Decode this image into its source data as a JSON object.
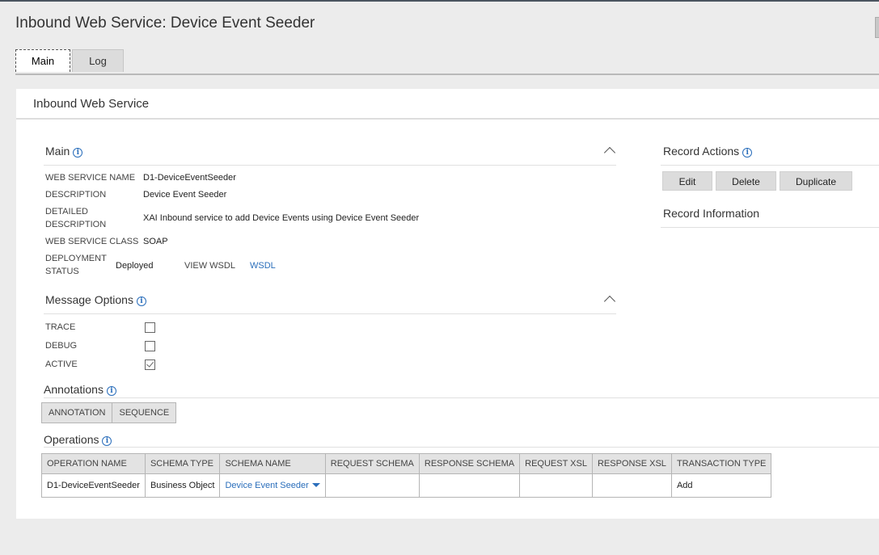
{
  "page": {
    "title": "Inbound Web Service: Device Event Seeder"
  },
  "tabs": [
    {
      "label": "Main"
    },
    {
      "label": "Log"
    }
  ],
  "card": {
    "title": "Inbound Web Service"
  },
  "main_section": {
    "title": "Main",
    "fields": {
      "web_service_name": {
        "label": "WEB SERVICE NAME",
        "value": "D1-DeviceEventSeeder"
      },
      "description": {
        "label": "DESCRIPTION",
        "value": "Device Event Seeder"
      },
      "detailed_description": {
        "label_line1": "DETAILED",
        "label_line2": "DESCRIPTION",
        "value": "XAI Inbound service to add Device Events using Device Event Seeder"
      },
      "web_service_class": {
        "label": "WEB SERVICE CLASS",
        "value": "SOAP"
      },
      "deployment_status": {
        "label_line1": "DEPLOYMENT",
        "label_line2": "STATUS",
        "value": "Deployed"
      },
      "view_wsdl": {
        "label": "VIEW WSDL",
        "value": "WSDL"
      }
    }
  },
  "message_options": {
    "title": "Message Options",
    "trace": {
      "label": "TRACE",
      "checked": false
    },
    "debug": {
      "label": "DEBUG",
      "checked": false
    },
    "active": {
      "label": "ACTIVE",
      "checked": true
    }
  },
  "annotations": {
    "title": "Annotations",
    "columns": [
      "ANNOTATION",
      "SEQUENCE"
    ]
  },
  "operations": {
    "title": "Operations",
    "columns": [
      "OPERATION NAME",
      "SCHEMA TYPE",
      "SCHEMA NAME",
      "REQUEST SCHEMA",
      "RESPONSE SCHEMA",
      "REQUEST XSL",
      "RESPONSE XSL",
      "TRANSACTION TYPE"
    ],
    "rows": [
      {
        "operation_name": "D1-DeviceEventSeeder",
        "schema_type": "Business Object",
        "schema_name": "Device Event Seeder",
        "request_schema": "",
        "response_schema": "",
        "request_xsl": "",
        "response_xsl": "",
        "transaction_type": "Add"
      }
    ]
  },
  "record_actions": {
    "title": "Record Actions",
    "edit": "Edit",
    "delete": "Delete",
    "duplicate": "Duplicate"
  },
  "record_information": {
    "title": "Record Information"
  },
  "colors": {
    "link": "#2a6ebb",
    "background": "#ececec",
    "header_bar": "#4a5560"
  }
}
